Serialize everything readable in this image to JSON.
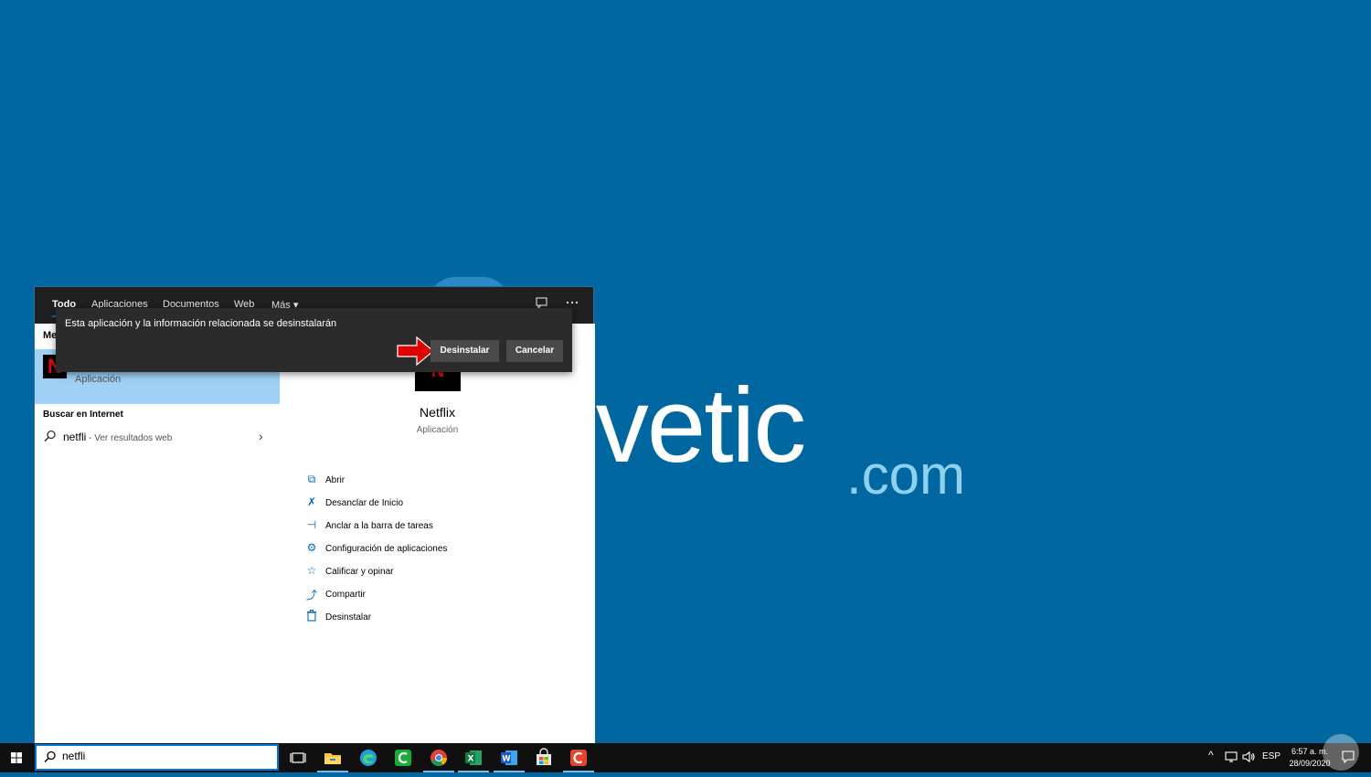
{
  "colors": {
    "desktop_bg": "#0067a0",
    "panel_dark": "#202020",
    "accent": "#0078d7",
    "selection": "#9fd1f7",
    "netflix_red": "#e50914"
  },
  "wallpaper": {
    "logo_main": "lvetic",
    "logo_suffix": ".com"
  },
  "search_panel": {
    "tabs": [
      {
        "label": "Todo",
        "active": true
      },
      {
        "label": "Aplicaciones"
      },
      {
        "label": "Documentos"
      },
      {
        "label": "Web"
      },
      {
        "label": "Más"
      }
    ],
    "more_caret": "▾",
    "tab_icons": [
      "feedback-icon",
      "more-options-icon"
    ],
    "best_match_header": "Me",
    "best_match": {
      "tile_letter": "N",
      "subtitle": "Aplicación"
    },
    "web_header": "Buscar en Internet",
    "web_result": {
      "query": "netfli",
      "suffix": " - Ver resultados web"
    },
    "detail": {
      "app_name": "Netflix",
      "app_type": "Aplicación",
      "tile_letter": "N",
      "actions": [
        {
          "label": "Abrir",
          "icon": "open-icon",
          "glyph": "⧉"
        },
        {
          "label": "Desanclar de Inicio",
          "icon": "unpin-icon",
          "glyph": "✗"
        },
        {
          "label": "Anclar a la barra de tareas",
          "icon": "pin-icon",
          "glyph": "⊣"
        },
        {
          "label": "Configuración de aplicaciones",
          "icon": "gear-icon",
          "glyph": "⚙"
        },
        {
          "label": "Calificar y opinar",
          "icon": "star-icon",
          "glyph": "☆"
        },
        {
          "label": "Compartir",
          "icon": "share-icon",
          "glyph": "⤴"
        },
        {
          "label": "Desinstalar",
          "icon": "trash-icon",
          "glyph": "🗑"
        }
      ]
    }
  },
  "dialog": {
    "message": "Esta aplicación y la información relacionada se desinstalarán",
    "uninstall_label": "Desinstalar",
    "cancel_label": "Cancelar"
  },
  "taskbar": {
    "search_value": "netfli",
    "apps": [
      "task-view-icon",
      "file-explorer-icon",
      "edge-icon",
      "camtasia-icon",
      "chrome-icon",
      "excel-icon",
      "word-icon",
      "store-icon",
      "snagit-icon"
    ],
    "tray": {
      "chevron": "^",
      "language": "ESP"
    },
    "clock": {
      "time": "6:57 a. m.",
      "date": "28/09/2020"
    }
  }
}
